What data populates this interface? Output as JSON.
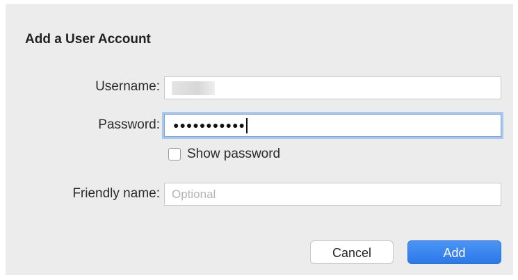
{
  "dialog": {
    "title": "Add a User Account",
    "username": {
      "label": "Username:",
      "value": ""
    },
    "password": {
      "label": "Password:",
      "masked_value": "●●●●●●●●●●●"
    },
    "show_password": {
      "label": "Show password",
      "checked": false
    },
    "friendly_name": {
      "label": "Friendly name:",
      "value": "",
      "placeholder": "Optional"
    },
    "buttons": {
      "cancel": "Cancel",
      "add": "Add"
    }
  },
  "colors": {
    "dialog_background": "#ececec",
    "focus_ring": "#a9c7ee",
    "primary_button": "#2c78e8"
  }
}
